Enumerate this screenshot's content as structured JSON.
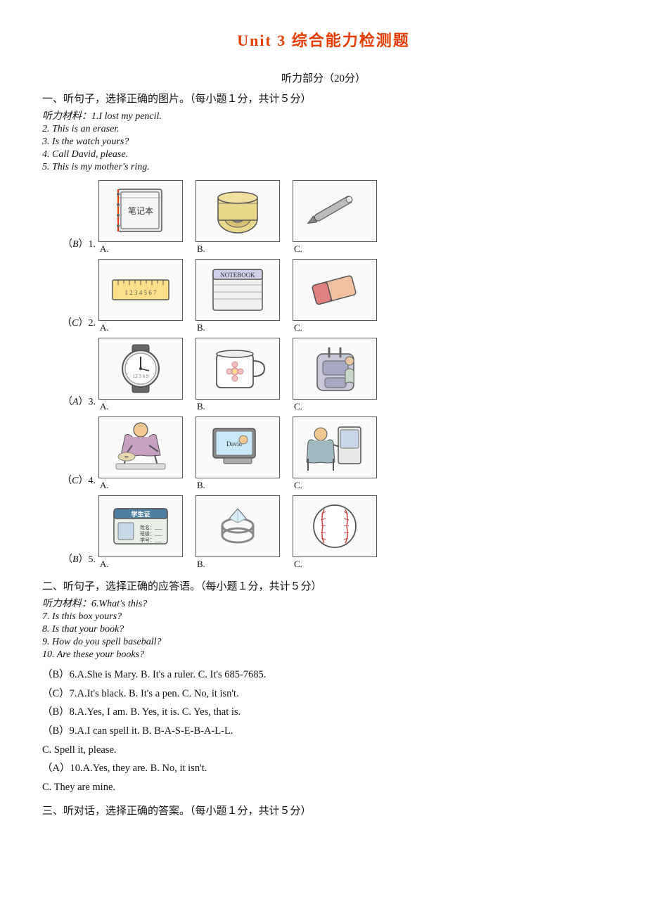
{
  "title": "Unit 3 综合能力检测题",
  "listening_header": "听力部分（20分）",
  "section1": {
    "label": "一、听句子，选择正确的图片。（每小题１分，共计５分）",
    "material_label": "听力材料：",
    "items": [
      "1.I lost my pencil.",
      "2. This is an eraser.",
      "3. Is the watch yours?",
      "4. Call David, please.",
      "5. This is my mother's ring."
    ],
    "rows": [
      {
        "answer": "（B）1.",
        "options": [
          "A.",
          "B.",
          "C."
        ]
      },
      {
        "answer": "（C）2.",
        "options": [
          "A.",
          "B.",
          "C."
        ]
      },
      {
        "answer": "（A）3.",
        "options": [
          "A.",
          "B.",
          "C."
        ]
      },
      {
        "answer": "（C）4.",
        "options": [
          "A.",
          "B.",
          "C."
        ]
      },
      {
        "answer": "（B）5.",
        "options": [
          "A.",
          "B.",
          "C."
        ]
      }
    ]
  },
  "section2": {
    "label": "二、听句子，选择正确的应答语。（每小题１分，共计５分）",
    "material_label": "听力材料：",
    "items": [
      "6.What's this?",
      "7. Is this box yours?",
      "8. Is that your book?",
      "9. How do you spell baseball?",
      "10. Are these your books?"
    ],
    "answers": [
      "（B）6.A.She is Mary.  B. It's a ruler.  C. It's 685-7685.",
      "（C）7.A.It's black.  B. It's a pen.  C. No, it isn't.",
      "（B）8.A.Yes, I am.  B. Yes, it is.  C. Yes, that is.",
      "（B）9.A.I can spell it.             B. B-A-S-E-B-A-L-L.",
      "C. Spell it, please.",
      "（A）10.A.Yes, they are.             B. No, it isn't.",
      "C. They are mine."
    ]
  },
  "section3": {
    "label": "三、听对话，选择正确的答案。（每小题１分，共计５分）"
  }
}
